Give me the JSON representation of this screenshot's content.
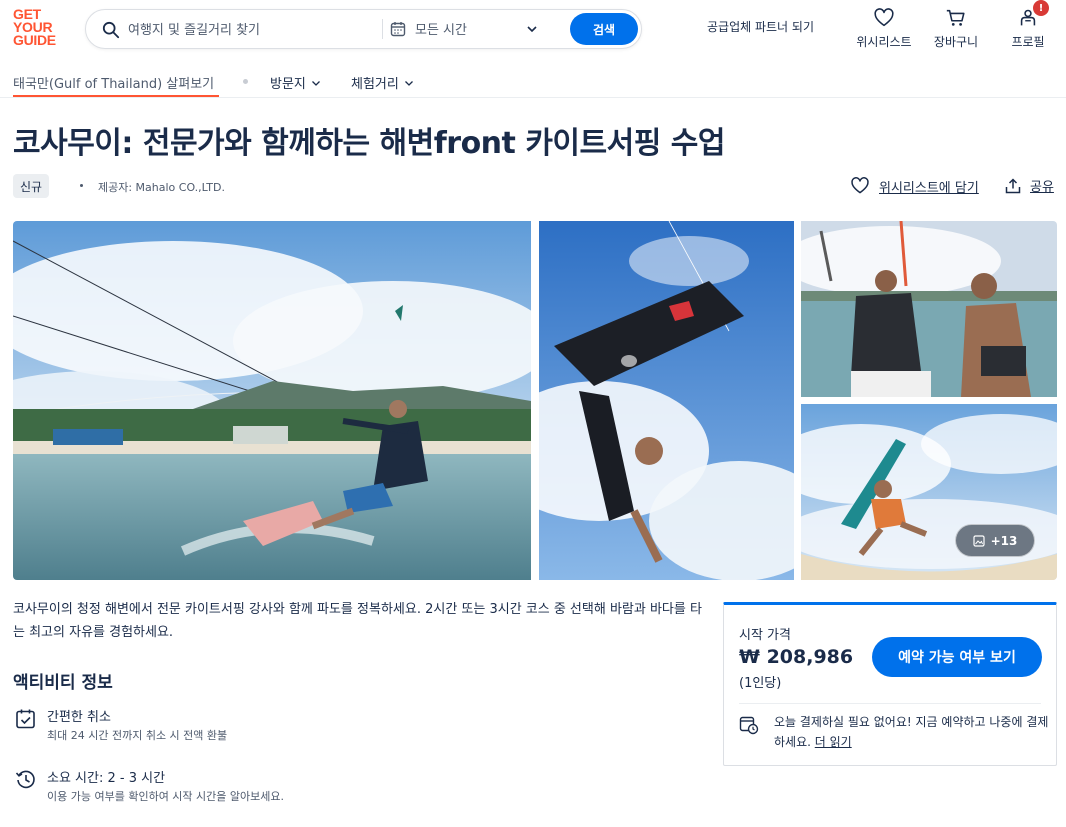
{
  "header": {
    "logo_lines": [
      "GET",
      "YOUR",
      "GUIDE"
    ],
    "search_placeholder": "여행지 및 즐길거리 찾기",
    "date_label": "모든 시간",
    "search_button": "검색",
    "partner_link": "공급업체 파트너 되기",
    "wishlist_label": "위시리스트",
    "cart_label": "장바구니",
    "profile_label": "프로필",
    "profile_badge": "!"
  },
  "subnav": {
    "explore": "태국만(Gulf of Thailand) 살펴보기",
    "places": "방문지",
    "experiences": "체험거리"
  },
  "activity": {
    "title": "코사무이: 전문가와 함께하는 해변front 카이트서핑 수업",
    "tag": "신규",
    "provider": "제공자: Mahalo CO.,LTD.",
    "wishlist_add": "위시리스트에 담기",
    "share": "공유"
  },
  "gallery": {
    "more_count": "+13"
  },
  "description": "코사무이의 청정 해변에서 전문 카이트서핑 강사와 함께 파도를 정복하세요. 2시간 또는 3시간 코스 중 선택해 바람과 바다를 타는 최고의 자유를 경험하세요.",
  "info": {
    "section_title": "액티비티 정보",
    "cancel_title": "간편한 취소",
    "cancel_desc": "최대 24 시간 전까지 취소 시 전액 환불",
    "duration_title": "소요 시간: 2 - 3 시간",
    "duration_desc": "이용 가능 여부를 확인하여 시작 시간을 알아보세요."
  },
  "booking": {
    "from_label": "시작 가격",
    "price": "₩ 208,986",
    "per_person": "(1인당)",
    "check_button": "예약 가능 여부 보기",
    "pay_later_text": "오늘 결제하실 필요 없어요! 지금 예약하고 나중에 결제하세요. ",
    "read_more": "더 읽기"
  },
  "colors": {
    "brand_orange": "#ff5533",
    "primary_blue": "#0071eb",
    "text_dark": "#1a2b49",
    "badge_red": "#d83a36"
  }
}
